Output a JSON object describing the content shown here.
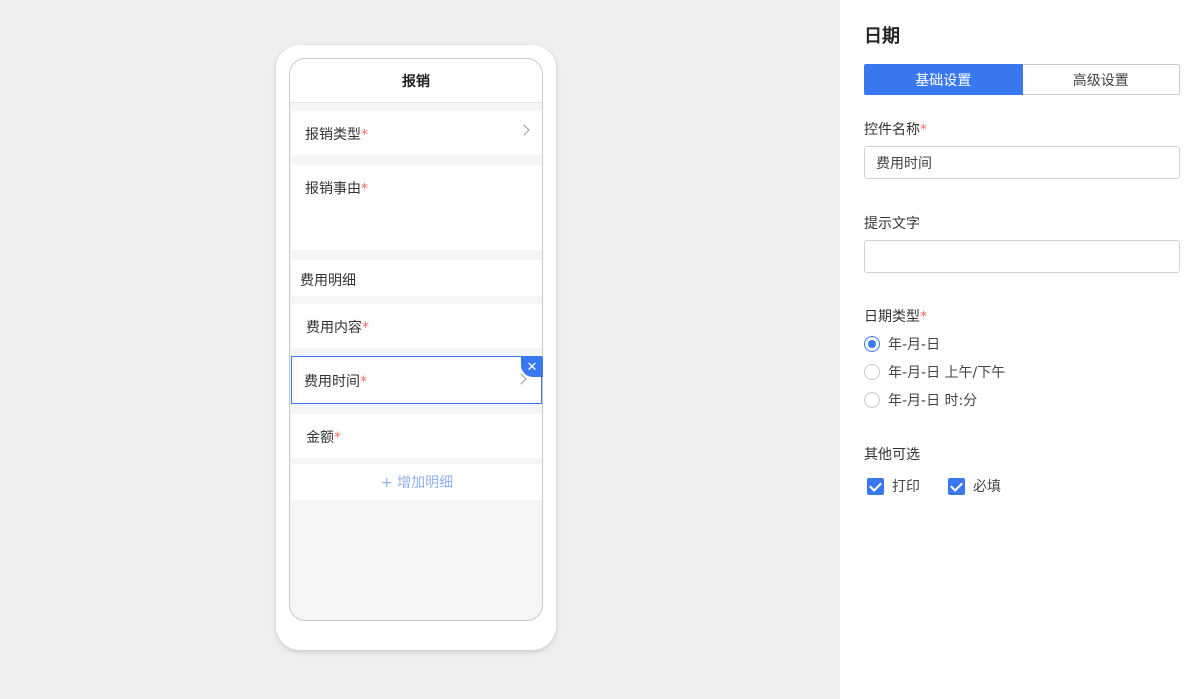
{
  "phone": {
    "title": "报销",
    "fields": {
      "type": "报销类型",
      "reason": "报销事由",
      "section": "费用明细",
      "content": "费用内容",
      "time": "费用时间",
      "amount": "金额"
    },
    "required_mark": "*",
    "add_detail": "+ 增加明细",
    "delete_symbol": "✕"
  },
  "panel": {
    "title": "日期",
    "tabs": {
      "basic": "基础设置",
      "advanced": "高级设置"
    },
    "control_name_label": "控件名称",
    "control_name_value": "费用时间",
    "hint_label": "提示文字",
    "hint_value": "",
    "date_type_label": "日期类型",
    "date_options": [
      "年-月-日",
      "年-月-日 上午/下午",
      "年-月-日 时:分"
    ],
    "selected_option_index": 0,
    "other_label": "其他可选",
    "checkboxes": {
      "print": "打印",
      "required": "必填"
    }
  },
  "colors": {
    "accent": "#3a78f2",
    "required": "#f56c6c"
  }
}
